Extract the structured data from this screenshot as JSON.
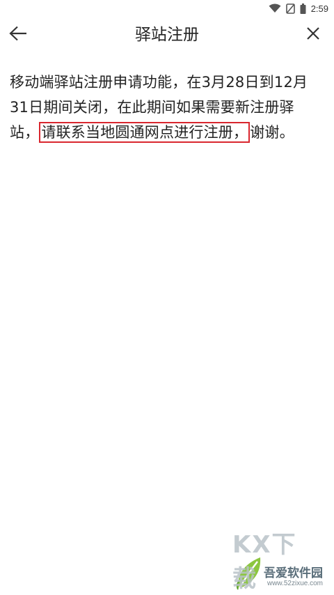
{
  "status_bar": {
    "time": "2:59",
    "icons": [
      "wifi-icon",
      "no-signal-icon",
      "battery-icon"
    ]
  },
  "app_bar": {
    "title": "驿站注册",
    "back_icon": "arrow-left-icon",
    "close_icon": "close-icon"
  },
  "content": {
    "text_before": "移动端驿站注册申请功能，在3月28日到12月31日期间关闭，在此期间如果需要新注册驿站，",
    "highlighted_text": "请联系当地圆通网点进行注册，",
    "text_after": "谢谢。",
    "highlight_color": "#d9262e"
  },
  "watermark": {
    "logo_text": "KX下载",
    "name": "吾爱软件园",
    "url": "www.52zixue.com"
  }
}
